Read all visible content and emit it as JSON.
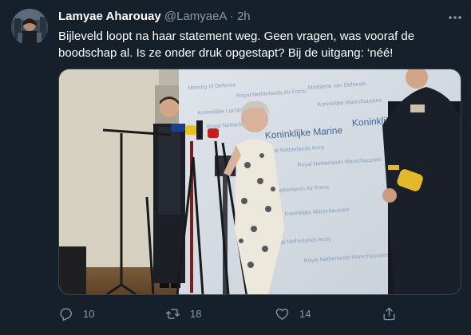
{
  "tweet": {
    "display_name": "Lamyae Aharouay",
    "handle": "@LamyaeA",
    "separator": "·",
    "time": "2h",
    "text": "Bijleveld loopt na haar statement weg. Geen vragen, was vooraf de boodschap al. Is ze onder druk opgestapt? Bij de uitgang: ‘néé!",
    "backdrop_lines": [
      "Ministry of Defence",
      "Ministerie van Defensie",
      "Koninklijke Luchtmacht",
      "Royal Netherlands Air Force",
      "Koninklijke Marine",
      "Koninklijke Landmacht",
      "Royal Netherlands Navy",
      "Royal Netherlands Army",
      "Koninklijke Marechaussee",
      "Royal Netherlands Marechaussee"
    ]
  },
  "actions": {
    "reply_count": "10",
    "retweet_count": "18",
    "like_count": "14"
  },
  "icons": {
    "more": "more-horizontal-icon",
    "reply": "reply-icon",
    "retweet": "retweet-icon",
    "like": "heart-icon",
    "share": "share-icon"
  },
  "colors": {
    "background": "#15202b",
    "secondary_text": "#8899a6",
    "border": "#38444d"
  }
}
